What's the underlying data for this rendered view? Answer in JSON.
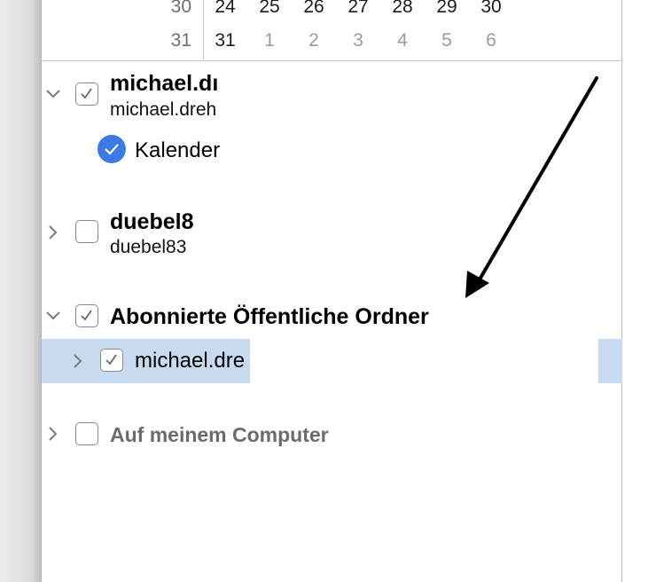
{
  "mini_calendar": {
    "rows": [
      {
        "week": "30",
        "days": [
          {
            "d": "24",
            "cur": true
          },
          {
            "d": "25",
            "cur": true
          },
          {
            "d": "26",
            "cur": true
          },
          {
            "d": "27",
            "cur": true
          },
          {
            "d": "28",
            "cur": true
          },
          {
            "d": "29",
            "cur": true
          },
          {
            "d": "30",
            "cur": true
          }
        ]
      },
      {
        "week": "31",
        "days": [
          {
            "d": "31",
            "cur": true
          },
          {
            "d": "1",
            "cur": false
          },
          {
            "d": "2",
            "cur": false
          },
          {
            "d": "3",
            "cur": false
          },
          {
            "d": "4",
            "cur": false
          },
          {
            "d": "5",
            "cur": false
          },
          {
            "d": "6",
            "cur": false
          }
        ]
      }
    ]
  },
  "accounts": {
    "michael": {
      "title": "michael.dı",
      "subtitle": "michael.dreh",
      "calendar": "Kalender"
    },
    "duebel": {
      "title": "duebel8",
      "subtitle": "duebel83"
    },
    "public": {
      "title": "Abonnierte Öffentliche Ordner",
      "item": "michael.dre"
    },
    "local": {
      "title": "Auf meinem Computer"
    }
  },
  "colors": {
    "selection": "#c7daf0",
    "accent": "#3c7be3"
  }
}
